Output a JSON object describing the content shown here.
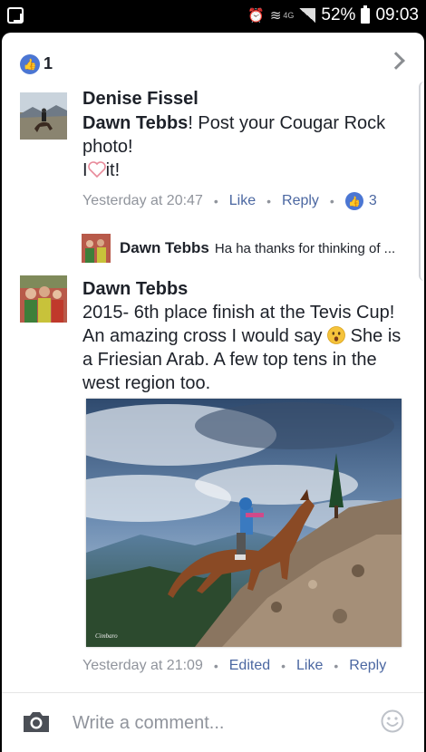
{
  "status_bar": {
    "battery_percent": "52%",
    "time": "09:03",
    "network": "4G"
  },
  "header": {
    "like_count": "1"
  },
  "comments": [
    {
      "author": "Denise Fissel",
      "mention": "Dawn Tebbs",
      "text_after_mention": "! Post your Cougar Rock photo!",
      "line2_prefix": "I",
      "line2_suffix": "it!",
      "timestamp": "Yesterday at 20:47",
      "like_label": "Like",
      "reply_label": "Reply",
      "reaction_count": "3"
    },
    {
      "author": "Dawn Tebbs",
      "text_before_emoji": "2015- 6th place finish at the Tevis Cup! An amazing cross I would say",
      "text_after_emoji": " She is a Friesian Arab. A few top tens in the west region too.",
      "timestamp": "Yesterday at 21:09",
      "edited_label": "Edited",
      "like_label": "Like",
      "reply_label": "Reply"
    }
  ],
  "reply_preview": {
    "author": "Dawn Tebbs",
    "text": "Ha ha thanks for thinking of ..."
  },
  "composer": {
    "placeholder": "Write a comment..."
  },
  "colors": {
    "link_blue": "#4b67a1",
    "badge_blue": "#4b76d3",
    "meta_grey": "#90949c",
    "text_dark": "#1d2129"
  }
}
